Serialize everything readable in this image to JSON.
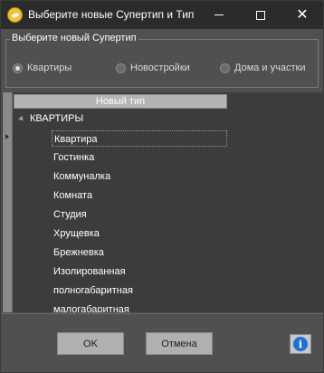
{
  "window": {
    "title": "Выберите новые Супертип и Тип",
    "icon": "app-icon",
    "controls": {
      "minimize": "minimize-icon",
      "maximize": "maximize-icon",
      "close": "close-icon"
    }
  },
  "supertype_group": {
    "legend": "Выберите новый Супертип",
    "options": [
      {
        "label": "Квартиры",
        "checked": true
      },
      {
        "label": "Новостройки",
        "checked": false
      },
      {
        "label": "Дома и участки",
        "checked": false
      }
    ]
  },
  "grid": {
    "column_header": "Новый тип",
    "root": "КВАРТИРЫ",
    "items": [
      "Квартира",
      "Гостинка",
      "Коммуналка",
      "Комната",
      "Студия",
      "Хрущевка",
      "Брежневка",
      "Изолированная",
      "полногабаритная",
      "малогабаритная"
    ],
    "selected_index": 0
  },
  "buttons": {
    "ok": "OK",
    "cancel": "Отмена",
    "info_icon": "info-icon"
  },
  "colors": {
    "window_bg": "#505050",
    "titlebar_bg": "#2b2b2b",
    "grid_bg": "#3c3c3c",
    "button_bg": "#b0b0b0",
    "info_blue": "#1e6fd8",
    "app_icon_yellow": "#f2c230"
  }
}
